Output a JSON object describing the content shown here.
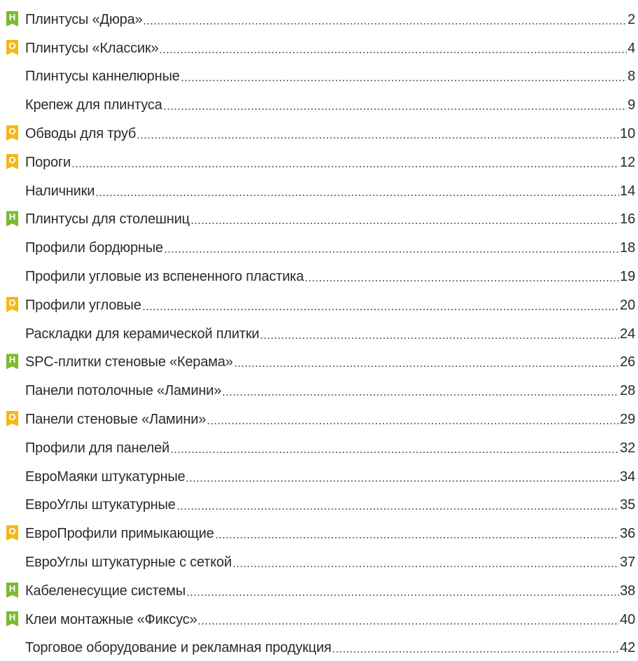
{
  "colors": {
    "new_badge": "#7dbb2c",
    "old_badge": "#f2b919",
    "text": "#2b2b2b"
  },
  "badge_letters": {
    "new": "Н",
    "old": "О"
  },
  "entries": [
    {
      "badge": "new",
      "title": "Плинтусы «Дюра»",
      "page": "2"
    },
    {
      "badge": "old",
      "title": "Плинтусы «Классик»",
      "page": "4"
    },
    {
      "badge": "",
      "title": "Плинтусы каннелюрные",
      "page": "8"
    },
    {
      "badge": "",
      "title": "Крепеж для плинтуса",
      "page": "9"
    },
    {
      "badge": "old",
      "title": "Обводы для труб",
      "page": "10"
    },
    {
      "badge": "old",
      "title": "Пороги",
      "page": "12"
    },
    {
      "badge": "",
      "title": "Наличники",
      "page": "14"
    },
    {
      "badge": "new",
      "title": "Плинтусы для столешниц",
      "page": "16"
    },
    {
      "badge": "",
      "title": "Профили бордюрные",
      "page": "18"
    },
    {
      "badge": "",
      "title": "Профили угловые из вспененного пластика",
      "page": "19"
    },
    {
      "badge": "old",
      "title": "Профили угловые",
      "page": "20"
    },
    {
      "badge": "",
      "title": "Раскладки для керамической плитки",
      "page": "24"
    },
    {
      "badge": "new",
      "title": "SPC-плитки стеновые «Керама»",
      "page": "26"
    },
    {
      "badge": "",
      "title": "Панели потолочные «Ламини»",
      "page": "28"
    },
    {
      "badge": "old",
      "title": "Панели стеновые «Ламини»",
      "page": "29"
    },
    {
      "badge": "",
      "title": "Профили для панелей",
      "page": "32"
    },
    {
      "badge": "",
      "title": "ЕвроМаяки штукатурные",
      "page": "34"
    },
    {
      "badge": "",
      "title": "ЕвроУглы штукатурные",
      "page": "35"
    },
    {
      "badge": "old",
      "title": "ЕвроПрофили примыкающие",
      "page": "36"
    },
    {
      "badge": "",
      "title": "ЕвроУглы штукатурные с сеткой",
      "page": "37"
    },
    {
      "badge": "new",
      "title": "Кабеленесущие системы",
      "page": "38"
    },
    {
      "badge": "new",
      "title": "Клеи монтажные «Фиксус»",
      "page": "40"
    },
    {
      "badge": "",
      "title": "Торговое оборудование и рекламная продукция",
      "page": "42"
    }
  ]
}
